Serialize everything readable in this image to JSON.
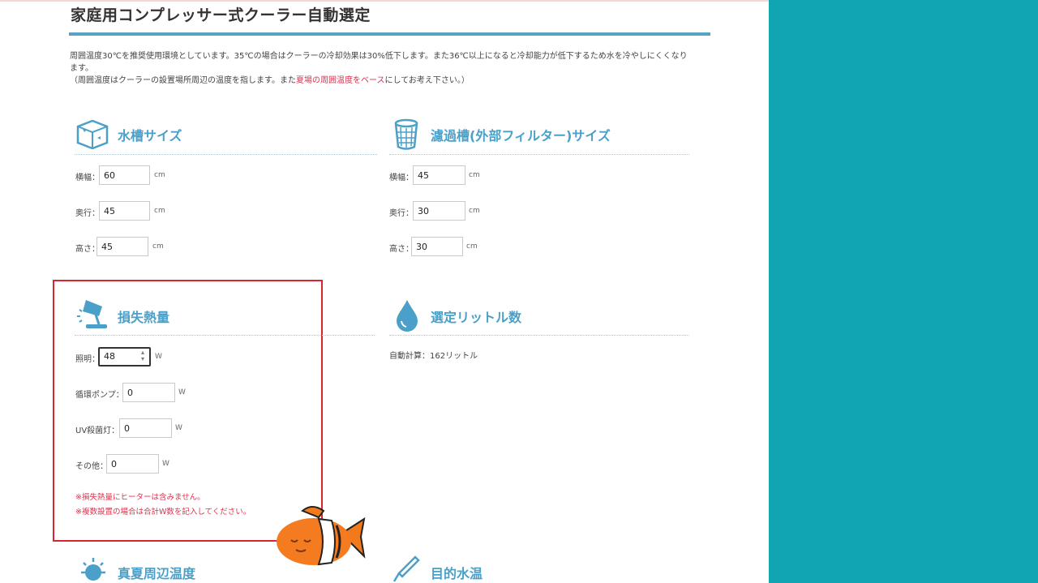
{
  "page": {
    "title": "家庭用コンプレッサー式クーラー自動選定",
    "intro_line1": "周囲温度30℃を推奨使用環境としています。35℃の場合はクーラーの冷却効果は30%低下します。また36℃以上になると冷却能力が低下するため水を冷やしにくくなり",
    "intro_line2": "ます。",
    "intro_line3_a": "（周囲温度はクーラーの設置場所周辺の温度を指します。また",
    "intro_line3_red": "夏場の周囲温度をベース",
    "intro_line3_b": "にしてお考え下さい。）"
  },
  "tank": {
    "title": "水槽サイズ",
    "width_label": "横幅：",
    "width_value": "60",
    "width_unit": "cm",
    "depth_label": "奥行：",
    "depth_value": "45",
    "depth_unit": "cm",
    "height_label": "高さ：",
    "height_value": "45",
    "height_unit": "cm"
  },
  "filter": {
    "title": "濾過槽(外部フィルター)サイズ",
    "width_label": "横幅：",
    "width_value": "45",
    "width_unit": "cm",
    "depth_label": "奥行：",
    "depth_value": "30",
    "depth_unit": "cm",
    "height_label": "高さ：",
    "height_value": "30",
    "height_unit": "cm"
  },
  "heat_loss": {
    "title": "損失熱量",
    "lighting_label": "照明：",
    "lighting_value": "48",
    "lighting_unit": "W",
    "pump_label": "循環ポンプ：",
    "pump_value": "0",
    "pump_unit": "W",
    "uv_label": "UV殺菌灯：",
    "uv_value": "0",
    "uv_unit": "W",
    "other_label": "その他：",
    "other_value": "0",
    "other_unit": "W",
    "note1": "※損失熱量にヒーターは含みません。",
    "note2": "※複数設置の場合は合計W数を記入してください。"
  },
  "liters": {
    "title": "選定リットル数",
    "auto_calc": "自動計算：162リットル"
  },
  "summer_temp": {
    "title": "真夏周辺温度"
  },
  "target_temp": {
    "title": "目的水温"
  },
  "colors": {
    "accent": "#4aa0c8",
    "highlight": "#d8262e",
    "panel": "#11a4b2",
    "note": "#e0304c"
  }
}
